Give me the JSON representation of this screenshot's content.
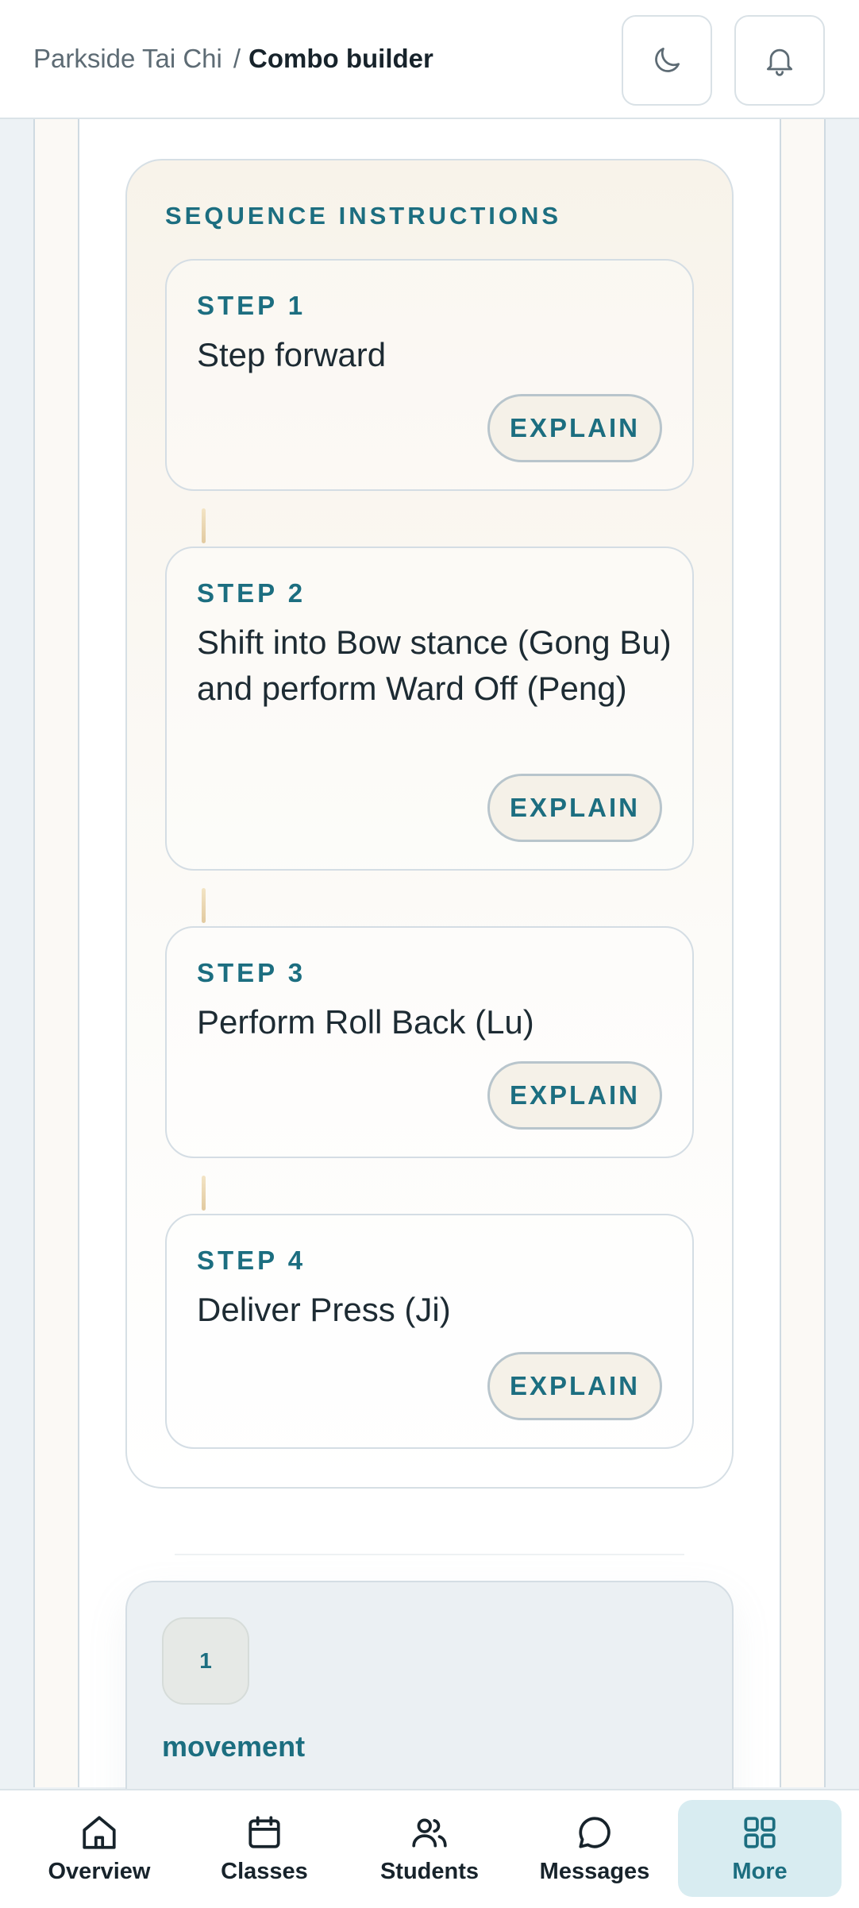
{
  "header": {
    "breadcrumb_parent": "Parkside Tai Chi",
    "breadcrumb_separator": "/",
    "breadcrumb_current": "Combo builder",
    "theme_toggle_icon": "moon-icon",
    "notifications_icon": "bell-icon"
  },
  "instructions": {
    "title": "SEQUENCE INSTRUCTIONS",
    "steps": [
      {
        "label": "STEP 1",
        "text": "Step forward",
        "button": "EXPLAIN"
      },
      {
        "label": "STEP 2",
        "text": "Shift into Bow stance (Gong Bu) and perform Ward Off (Peng)",
        "button": "EXPLAIN"
      },
      {
        "label": "STEP 3",
        "text": "Perform Roll Back (Lu)",
        "button": "EXPLAIN"
      },
      {
        "label": "STEP 4",
        "text": "Deliver Press (Ji)",
        "button": "EXPLAIN"
      }
    ]
  },
  "movement_card": {
    "count": "1",
    "label": "movement"
  },
  "bottom_nav": {
    "items": [
      {
        "label": "Overview",
        "icon": "home-icon",
        "active": false
      },
      {
        "label": "Classes",
        "icon": "calendar-icon",
        "active": false
      },
      {
        "label": "Students",
        "icon": "users-icon",
        "active": false
      },
      {
        "label": "Messages",
        "icon": "chat-bubble-icon",
        "active": false
      },
      {
        "label": "More",
        "icon": "grid-icon",
        "active": true
      }
    ]
  },
  "colors": {
    "accent": "#1c6e80",
    "active_nav_bg": "#d8ecf1",
    "card_warm": "#f8f3ea"
  }
}
